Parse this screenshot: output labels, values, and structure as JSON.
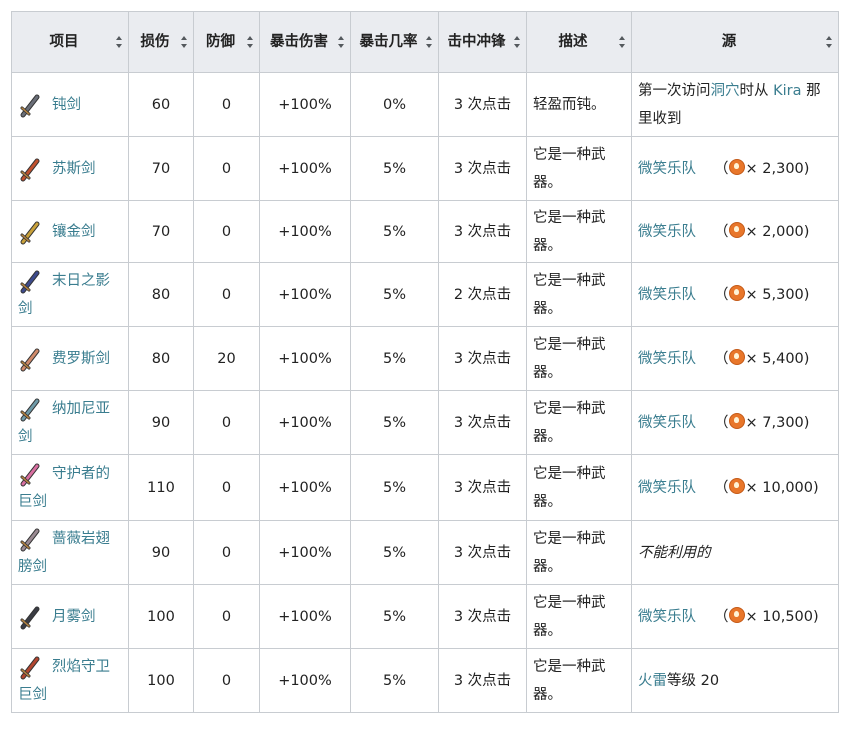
{
  "headers": [
    {
      "label": "项目"
    },
    {
      "label": "损伤"
    },
    {
      "label": "防御"
    },
    {
      "label": "暴击伤害"
    },
    {
      "label": "暴击几率"
    },
    {
      "label": "击中冲锋"
    },
    {
      "label": "描述"
    },
    {
      "label": "源"
    }
  ],
  "rows": [
    {
      "name": "钝剑",
      "damage": "60",
      "defense": "0",
      "crit_dmg": "+100%",
      "crit_chance": "0%",
      "charge": "3 次点击",
      "desc": "轻盈而钝。",
      "source": {
        "type": "text",
        "parts": [
          "第一次访问",
          "洞穴",
          "时从 ",
          "Kira",
          " 那里收到"
        ]
      },
      "icon_color": "#6a6e78"
    },
    {
      "name": "苏斯剑",
      "damage": "70",
      "defense": "0",
      "crit_dmg": "+100%",
      "crit_chance": "5%",
      "charge": "3 次点击",
      "desc": "它是一种武器。",
      "source": {
        "type": "shop",
        "shop": "微笑乐队",
        "price": "× 2,300)"
      },
      "icon_color": "#c0502d"
    },
    {
      "name": "镶金剑",
      "damage": "70",
      "defense": "0",
      "crit_dmg": "+100%",
      "crit_chance": "5%",
      "charge": "3 次点击",
      "desc": "它是一种武器。",
      "source": {
        "type": "shop",
        "shop": "微笑乐队",
        "price": "× 2,000)"
      },
      "icon_color": "#c9a13a"
    },
    {
      "name": "末日之影剑",
      "damage": "80",
      "defense": "0",
      "crit_dmg": "+100%",
      "crit_chance": "5%",
      "charge": "2 次点击",
      "desc": "它是一种武器。",
      "source": {
        "type": "shop",
        "shop": "微笑乐队",
        "price": "× 5,300)"
      },
      "icon_color": "#3c4a8c"
    },
    {
      "name": "费罗斯剑",
      "damage": "80",
      "defense": "20",
      "crit_dmg": "+100%",
      "crit_chance": "5%",
      "charge": "3 次点击",
      "desc": "它是一种武器。",
      "source": {
        "type": "shop",
        "shop": "微笑乐队",
        "price": "× 5,400)"
      },
      "icon_color": "#d08a6a"
    },
    {
      "name": "纳加尼亚剑",
      "damage": "90",
      "defense": "0",
      "crit_dmg": "+100%",
      "crit_chance": "5%",
      "charge": "3 次点击",
      "desc": "它是一种武器。",
      "source": {
        "type": "shop",
        "shop": "微笑乐队",
        "price": "× 7,300)"
      },
      "icon_color": "#6e9aa8"
    },
    {
      "name": "守护者的巨剑",
      "damage": "110",
      "defense": "0",
      "crit_dmg": "+100%",
      "crit_chance": "5%",
      "charge": "3 次点击",
      "desc": "它是一种武器。",
      "source": {
        "type": "shop",
        "shop": "微笑乐队",
        "price": "× 10,000)"
      },
      "icon_color": "#d86fa0"
    },
    {
      "name": "蔷薇岩翅膀剑",
      "damage": "90",
      "defense": "0",
      "crit_dmg": "+100%",
      "crit_chance": "5%",
      "charge": "3 次点击",
      "desc": "它是一种武器。",
      "source": {
        "type": "italic",
        "text": "不能利用的"
      },
      "icon_color": "#9a8a92"
    },
    {
      "name": "月雾剑",
      "damage": "100",
      "defense": "0",
      "crit_dmg": "+100%",
      "crit_chance": "5%",
      "charge": "3 次点击",
      "desc": "它是一种武器。",
      "source": {
        "type": "shop",
        "shop": "微笑乐队",
        "price": "× 10,500)"
      },
      "icon_color": "#3a3c44"
    },
    {
      "name": "烈焰守卫巨剑",
      "damage": "100",
      "defense": "0",
      "crit_dmg": "+100%",
      "crit_chance": "5%",
      "charge": "3 次点击",
      "desc": "它是一种武器。",
      "source": {
        "type": "level",
        "link": "火雷",
        "text": "等级 20"
      },
      "icon_color": "#b2452f"
    }
  ],
  "shop_paren": "（",
  "colors": {
    "link": "#3a7d8f",
    "header_bg": "#eaecf0",
    "border": "#c8ccd1",
    "coin": "#e8762a"
  }
}
